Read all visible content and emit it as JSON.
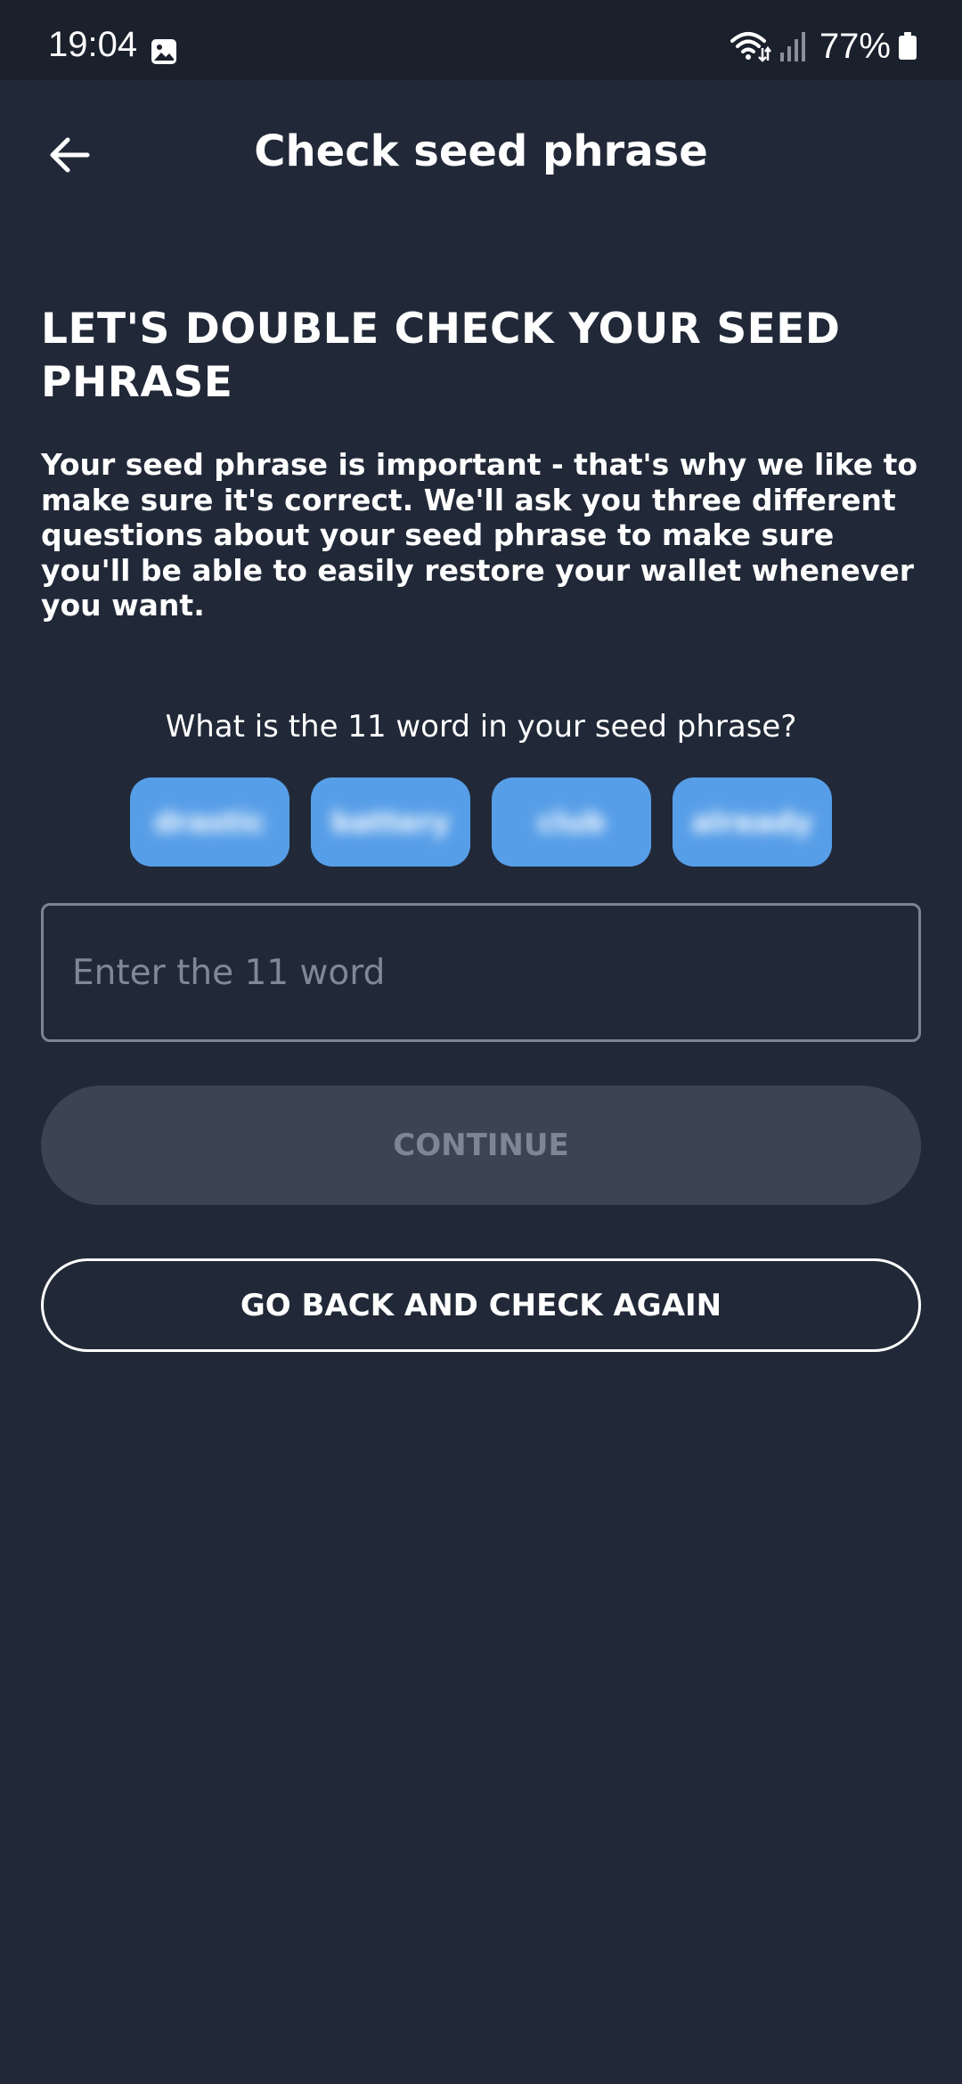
{
  "status_bar": {
    "time": "19:04",
    "battery": "77%",
    "icons": [
      "image-icon",
      "wifi-icon",
      "signal-icon",
      "battery-icon"
    ]
  },
  "header": {
    "title": "Check seed phrase",
    "back_icon": "arrow-left-icon"
  },
  "main": {
    "heading": "LET'S DOUBLE CHECK YOUR SEED PHRASE",
    "description": "Your seed phrase is important - that's why we like to make sure it's correct. We'll ask you three different questions about your seed phrase to make sure you'll be able to easily restore your wallet whenever you want.",
    "question": "What is the 11 word in your seed phrase?",
    "word_options": [
      "drastic",
      "battery",
      "club",
      "already"
    ],
    "input": {
      "placeholder": "Enter the 11 word",
      "value": ""
    },
    "continue_label": "CONTINUE",
    "go_back_label": "GO BACK AND CHECK AGAIN"
  },
  "colors": {
    "background": "#212938",
    "status_bar": "#1a202c",
    "chip": "#579ee8",
    "disabled_button": "#3a4453",
    "disabled_text": "#7d8694"
  }
}
